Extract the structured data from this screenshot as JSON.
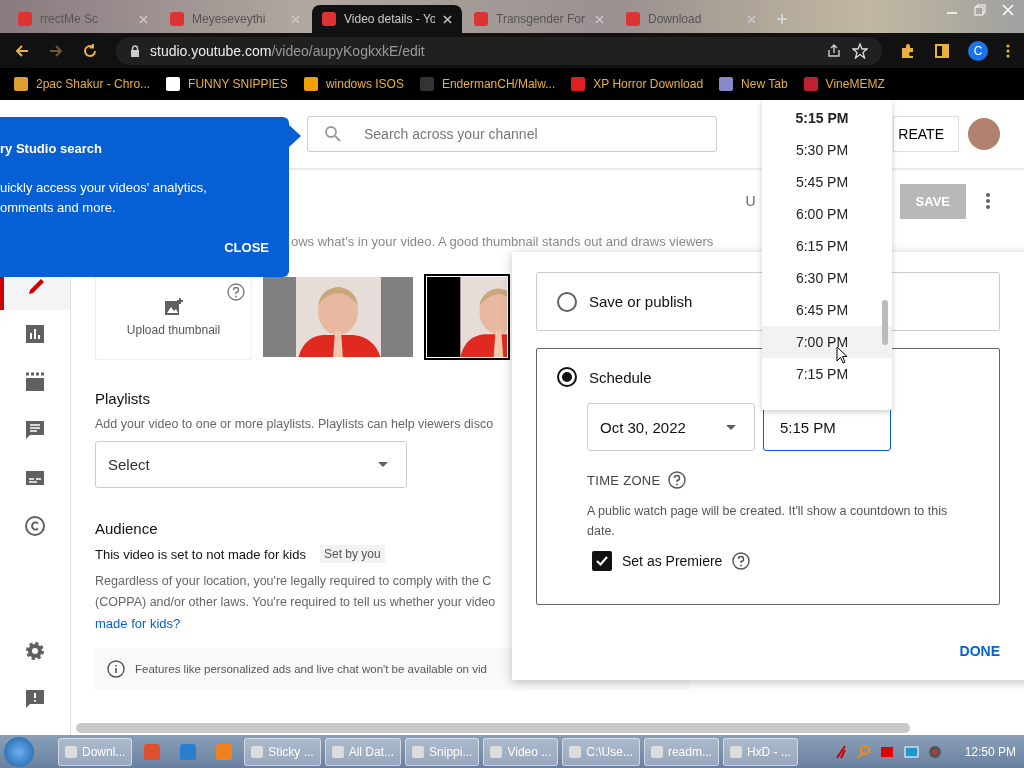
{
  "browser": {
    "tabs": [
      {
        "title": "rrectMe Sc",
        "selected": false
      },
      {
        "title": "Meyeseveythi",
        "selected": false
      },
      {
        "title": "Video details - Yo",
        "selected": true
      },
      {
        "title": "Transgender For",
        "selected": false
      },
      {
        "title": "Download",
        "selected": false
      }
    ],
    "address": {
      "host": "studio.youtube.com",
      "path": "/video/aupyKogkxkE/edit"
    },
    "profile_initial": "C",
    "bookmarks": [
      "2pac Shakur - Chro...",
      "FUNNY SNIPPIES",
      "windows ISOS",
      "EndermanCH/Malw...",
      "XP Horror Download",
      "New Tab",
      "VineMEMZ"
    ]
  },
  "header": {
    "search": {
      "placeholder": "Search across your channel"
    },
    "create_button": "REATE"
  },
  "sidebar": {
    "items": [
      {
        "kind": "edit",
        "selected": true
      },
      {
        "kind": "analytics",
        "selected": false
      },
      {
        "kind": "editor",
        "selected": false
      },
      {
        "kind": "comments",
        "selected": false
      },
      {
        "kind": "subtitles",
        "selected": false
      },
      {
        "kind": "copyright",
        "selected": false
      }
    ],
    "footer_items": [
      {
        "kind": "settings"
      },
      {
        "kind": "feedback"
      }
    ]
  },
  "toolbar": {
    "undo": "U",
    "save": {
      "label": "SAVE",
      "disabled": true
    }
  },
  "callout": {
    "title": "ry Studio search",
    "lines": [
      "uickly access your videos' analytics,",
      "omments and more."
    ],
    "close": "CLOSE"
  },
  "thumbnail": {
    "description": "ows what's in your video. A good thumbnail stands out and draws viewers",
    "upload_label": "Upload thumbnail",
    "options": [
      {
        "kind": "picture",
        "selected": false
      },
      {
        "kind": "picture",
        "selected": true
      }
    ]
  },
  "playlists": {
    "heading": "Playlists",
    "description": "Add your video to one or more playlists. Playlists can help viewers disco",
    "select": "Select"
  },
  "audience": {
    "heading": "Audience",
    "status": "This video is set to not made for kids",
    "chip": "Set by you",
    "lines": [
      "Regardless of your location, you're legally required to comply with the C",
      "(COPPA) and/or other laws. You're required to tell us whether your video"
    ],
    "link": "made for kids?",
    "info": "Features like personalized ads and live chat won't be available on vid"
  },
  "schedule_dialog": {
    "options": [
      {
        "label": "Save or publish",
        "selected": false
      },
      {
        "label": "Schedule",
        "selected": true
      }
    ],
    "date": "Oct 30, 2022",
    "time": "5:15 PM",
    "time_zone_label": "TIME ZONE",
    "description": "A public watch page will be created. It'll show a countdown to this date.",
    "premiere": {
      "label": "Set as Premiere",
      "checked": true
    },
    "done": "DONE"
  },
  "time_dropdown": [
    {
      "label": "5:15 PM",
      "selected": true,
      "hovered": false
    },
    {
      "label": "5:30 PM",
      "selected": false,
      "hovered": false
    },
    {
      "label": "5:45 PM",
      "selected": false,
      "hovered": false
    },
    {
      "label": "6:00 PM",
      "selected": false,
      "hovered": false
    },
    {
      "label": "6:15 PM",
      "selected": false,
      "hovered": false
    },
    {
      "label": "6:30 PM",
      "selected": false,
      "hovered": false
    },
    {
      "label": "6:45 PM",
      "selected": false,
      "hovered": false
    },
    {
      "label": "7:00 PM",
      "selected": false,
      "hovered": true
    },
    {
      "label": "7:15 PM",
      "selected": false,
      "hovered": false
    }
  ],
  "taskbar": {
    "items": [
      {
        "kind": "window",
        "label": "Downl..."
      },
      {
        "kind": "pinned"
      },
      {
        "kind": "pinned"
      },
      {
        "kind": "pinned"
      },
      {
        "kind": "window",
        "label": "Sticky ..."
      },
      {
        "kind": "window",
        "label": "All Dat..."
      },
      {
        "kind": "window",
        "label": "Snippi..."
      },
      {
        "kind": "window",
        "label": "Video ..."
      },
      {
        "kind": "window",
        "label": "C:\\Use..."
      },
      {
        "kind": "window",
        "label": "readm..."
      },
      {
        "kind": "window",
        "label": "HxD - ..."
      }
    ],
    "clock": "12:50 PM"
  }
}
